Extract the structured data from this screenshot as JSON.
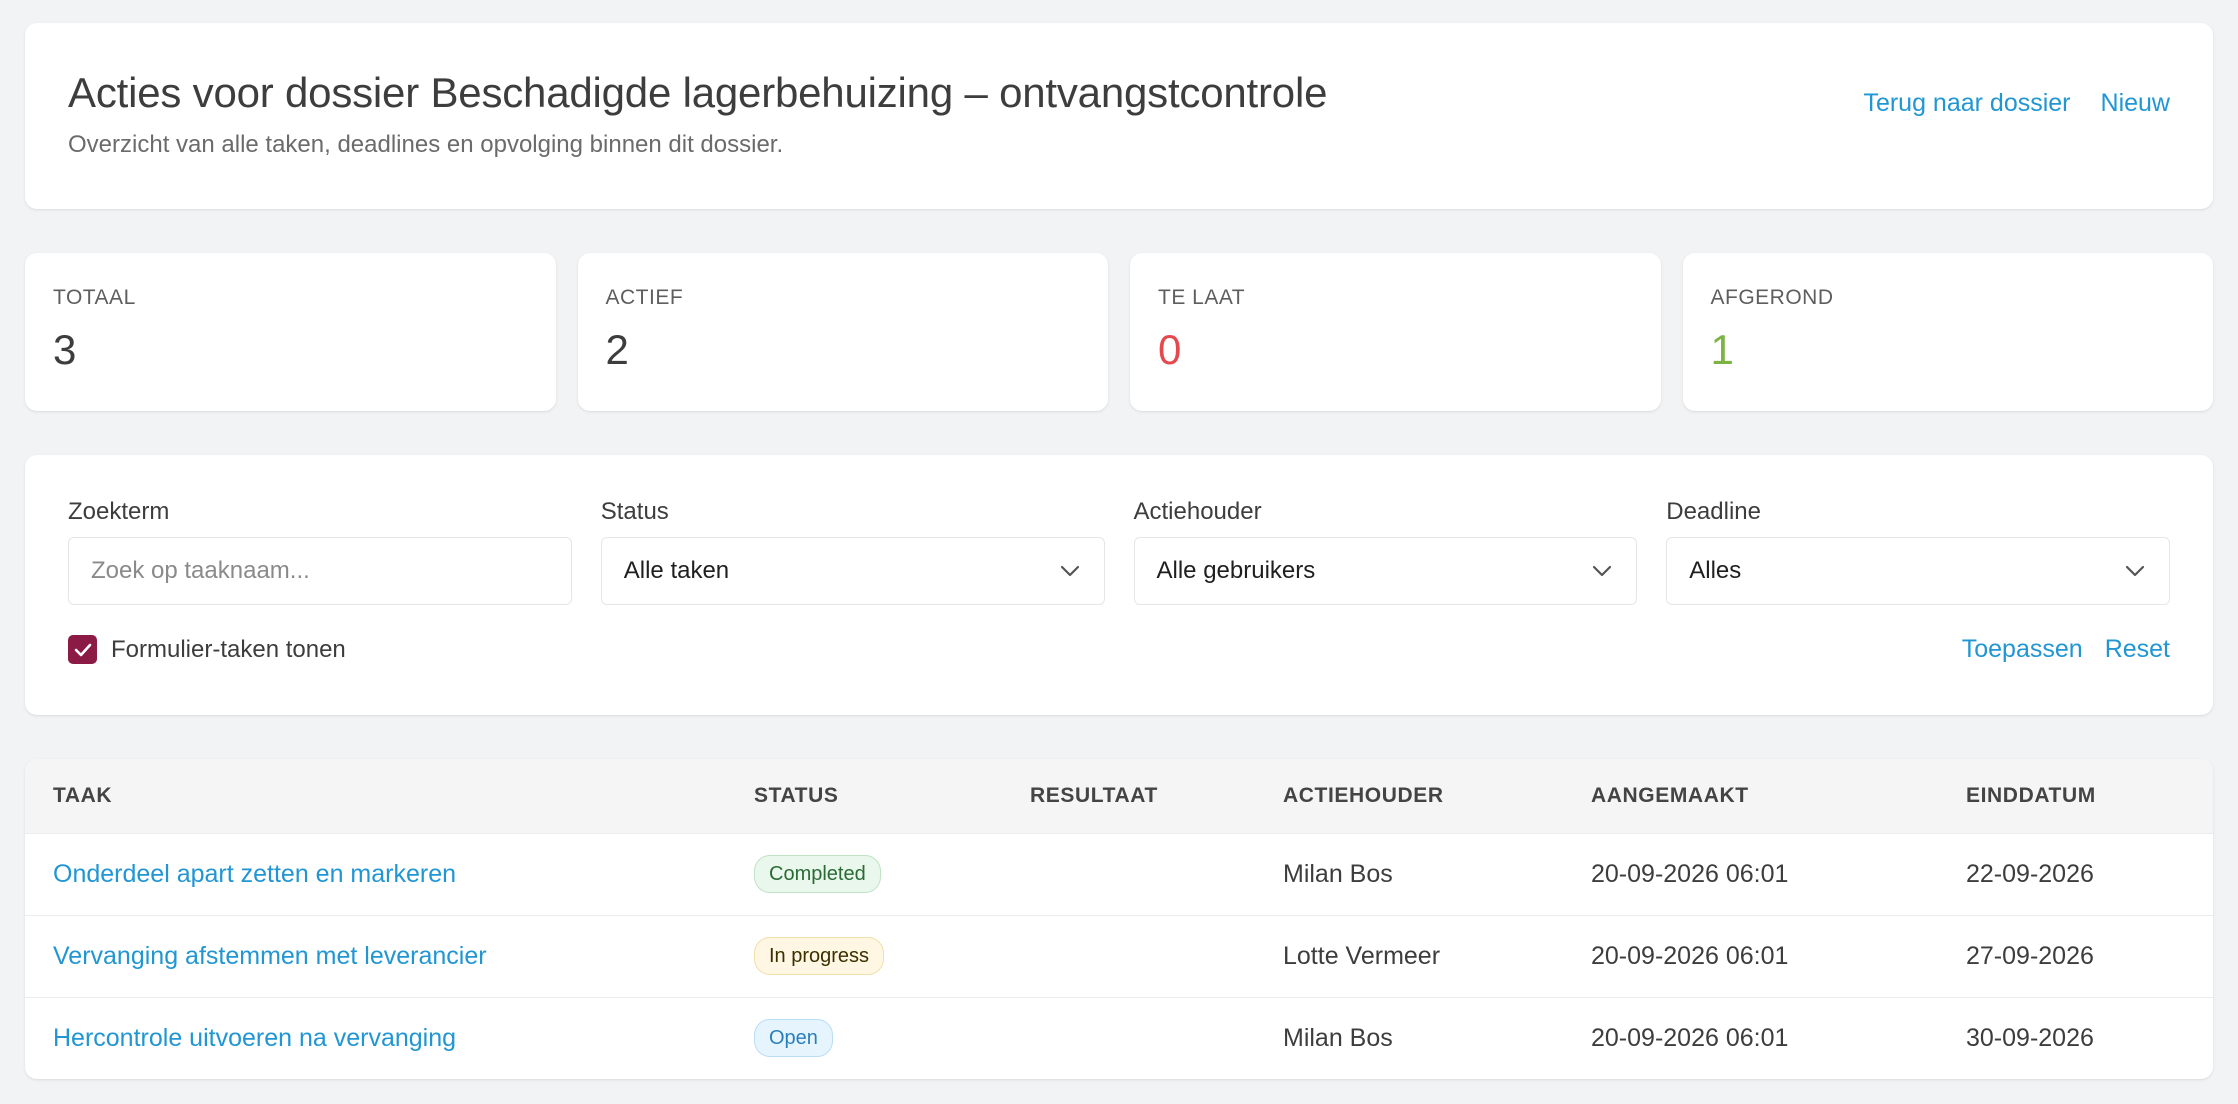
{
  "header": {
    "title": "Acties voor dossier Beschadigde lagerbehuizing – ontvangstcontrole",
    "subtitle": "Overzicht van alle taken, deadlines en opvolging binnen dit dossier.",
    "back_link": "Terug naar dossier",
    "new_link": "Nieuw"
  },
  "stats": [
    {
      "label": "Totaal",
      "value": "3"
    },
    {
      "label": "Actief",
      "value": "2"
    },
    {
      "label": "Te laat",
      "value": "0"
    },
    {
      "label": "Afgerond",
      "value": "1"
    }
  ],
  "filters": {
    "search": {
      "label": "Zoekterm",
      "placeholder": "Zoek op taaknaam...",
      "value": ""
    },
    "status": {
      "label": "Status",
      "value": "Alle taken"
    },
    "owner": {
      "label": "Actiehouder",
      "value": "Alle gebruikers"
    },
    "deadline": {
      "label": "Deadline",
      "value": "Alles"
    },
    "checkbox_label": "Formulier-taken tonen",
    "checkbox_checked": true,
    "apply_label": "Toepassen",
    "reset_label": "Reset"
  },
  "table": {
    "columns": [
      "Taak",
      "Status",
      "Resultaat",
      "Actiehouder",
      "Aangemaakt",
      "Einddatum"
    ],
    "rows": [
      {
        "task": "Onderdeel apart zetten en markeren",
        "status": "Completed",
        "result": "",
        "owner": "Milan Bos",
        "created": "20-09-2026 06:01",
        "due": "22-09-2026"
      },
      {
        "task": "Vervanging afstemmen met leverancier",
        "status": "In progress",
        "result": "",
        "owner": "Lotte Vermeer",
        "created": "20-09-2026 06:01",
        "due": "27-09-2026"
      },
      {
        "task": "Hercontrole uitvoeren na vervanging",
        "status": "Open",
        "result": "",
        "owner": "Milan Bos",
        "created": "20-09-2026 06:01",
        "due": "30-09-2026"
      }
    ]
  },
  "colors": {
    "link": "#2196d3",
    "late": "#e5484d",
    "done": "#7cb342",
    "checkbox": "#8b1a44"
  },
  "icons": {
    "chevron": "chevron-down-icon",
    "check": "check-icon"
  }
}
